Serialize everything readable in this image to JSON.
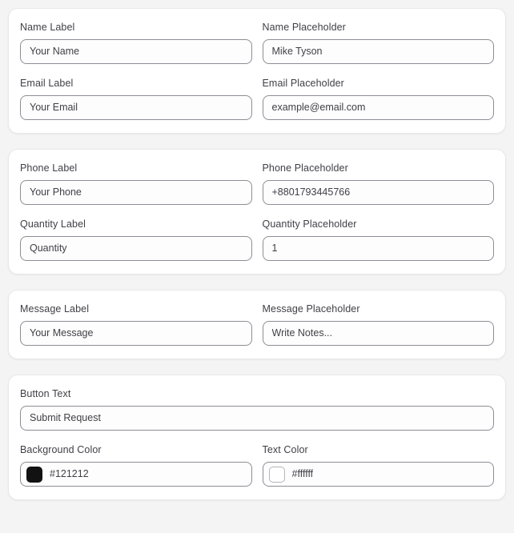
{
  "theme": {
    "page_background": "#f4f4f5",
    "card_background": "#ffffff",
    "input_border": "#8d8d95",
    "label_color": "#3f3f46"
  },
  "cards": [
    {
      "name": "contact-basic-card",
      "rows": [
        {
          "fields": [
            {
              "name": "name-label",
              "label": "Name Label",
              "value": "Your Name",
              "type": "text"
            },
            {
              "name": "name-placeholder",
              "label": "Name Placeholder",
              "value": "Mike Tyson",
              "type": "text"
            }
          ]
        },
        {
          "fields": [
            {
              "name": "email-label",
              "label": "Email Label",
              "value": "Your Email",
              "type": "text"
            },
            {
              "name": "email-placeholder",
              "label": "Email Placeholder",
              "value": "example@email.com",
              "type": "text"
            }
          ]
        }
      ]
    },
    {
      "name": "contact-details-card",
      "rows": [
        {
          "fields": [
            {
              "name": "phone-label",
              "label": "Phone Label",
              "value": "Your Phone",
              "type": "text"
            },
            {
              "name": "phone-placeholder",
              "label": "Phone Placeholder",
              "value": "+8801793445766",
              "type": "text"
            }
          ]
        },
        {
          "fields": [
            {
              "name": "quantity-label",
              "label": "Quantity Label",
              "value": "Quantity",
              "type": "text"
            },
            {
              "name": "quantity-placeholder",
              "label": "Quantity Placeholder",
              "value": "1",
              "type": "text"
            }
          ]
        }
      ]
    },
    {
      "name": "message-card",
      "rows": [
        {
          "fields": [
            {
              "name": "message-label",
              "label": "Message Label",
              "value": "Your Message",
              "type": "text"
            },
            {
              "name": "message-placeholder",
              "label": "Message Placeholder",
              "value": "Write Notes...",
              "type": "text"
            }
          ]
        }
      ]
    },
    {
      "name": "button-style-card",
      "rows": [
        {
          "fields": [
            {
              "name": "button-text",
              "label": "Button Text",
              "value": "Submit Request",
              "type": "text",
              "full": true
            }
          ]
        },
        {
          "fields": [
            {
              "name": "background-color",
              "label": "Background Color",
              "value": "#121212",
              "type": "color",
              "swatch": "#121212",
              "swatch_bordered": false
            },
            {
              "name": "text-color",
              "label": "Text Color",
              "value": "#ffffff",
              "type": "color",
              "swatch": "#ffffff",
              "swatch_bordered": true
            }
          ]
        }
      ]
    }
  ]
}
